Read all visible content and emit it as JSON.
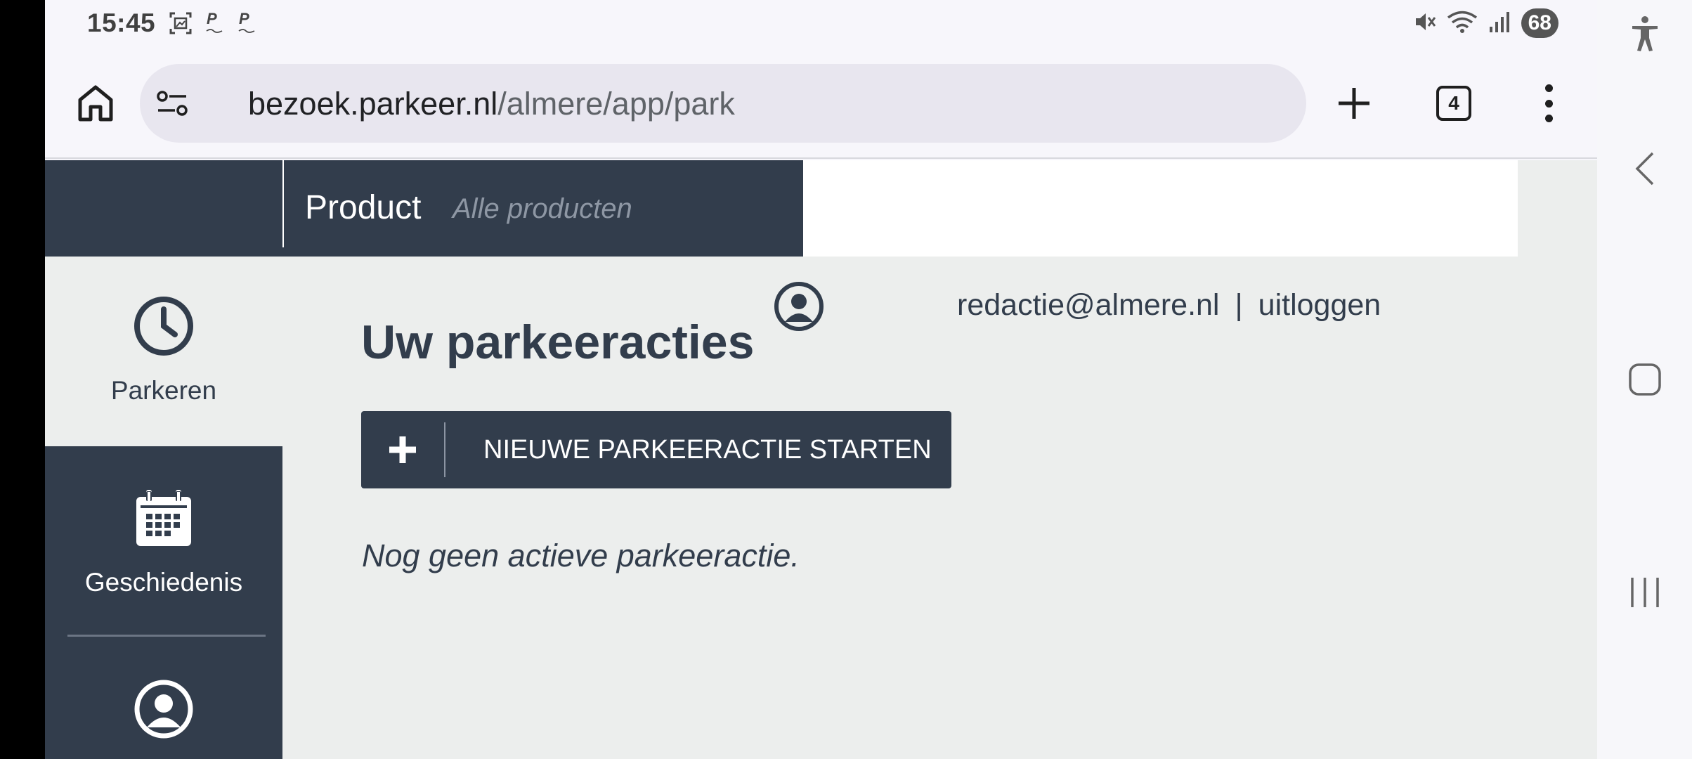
{
  "status_bar": {
    "time": "15:45",
    "battery": "68",
    "left_icons": [
      "screenshot-icon",
      "parking-app-icon",
      "parking-app-icon"
    ],
    "right_icons": [
      "mute-icon",
      "wifi-icon",
      "signal-icon"
    ]
  },
  "browser": {
    "url_domain": "bezoek.parkeer.nl",
    "url_path": "/almere/app/park",
    "tab_count": "4"
  },
  "header": {
    "product_label": "Product",
    "product_hint": "Alle producten"
  },
  "sidebar": {
    "items": [
      {
        "label": "Parkeren",
        "icon": "clock-icon",
        "active": true
      },
      {
        "label": "Geschiedenis",
        "icon": "calendar-icon",
        "active": false
      },
      {
        "label": "",
        "icon": "user-circle-icon",
        "active": false
      }
    ]
  },
  "user": {
    "email": "redactie@almere.nl",
    "separator": "|",
    "logout": "uitloggen"
  },
  "main": {
    "title": "Uw parkeeracties",
    "start_button": "NIEUWE PARKEERACTIE STARTEN",
    "empty_message": "Nog geen actieve parkeeractie."
  },
  "colors": {
    "navy": "#323d4c",
    "content_bg": "#eceeed",
    "url_bar": "#e8e6ef"
  }
}
